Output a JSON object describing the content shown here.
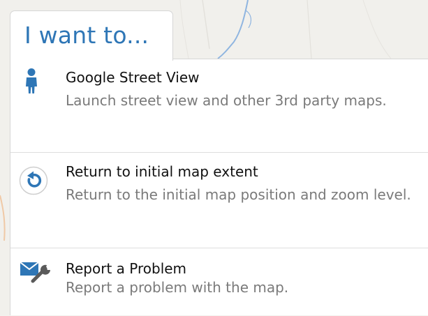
{
  "panel": {
    "tab_title": "I want to..."
  },
  "menu": {
    "items": [
      {
        "icon": "street-view-person-icon",
        "title": "Google Street View",
        "description": "Launch street view and other 3rd party maps."
      },
      {
        "icon": "return-extent-icon",
        "title": "Return to initial map extent",
        "description": "Return to the initial map position and zoom level."
      },
      {
        "icon": "report-problem-icon",
        "title": "Report a Problem",
        "description": "Report a problem with the map."
      }
    ]
  },
  "colors": {
    "accent": "#2e76b6",
    "title_text": "#111111",
    "description_text": "#7a7a7a",
    "divider": "#dedede",
    "map_water": "#8fb5e0"
  }
}
